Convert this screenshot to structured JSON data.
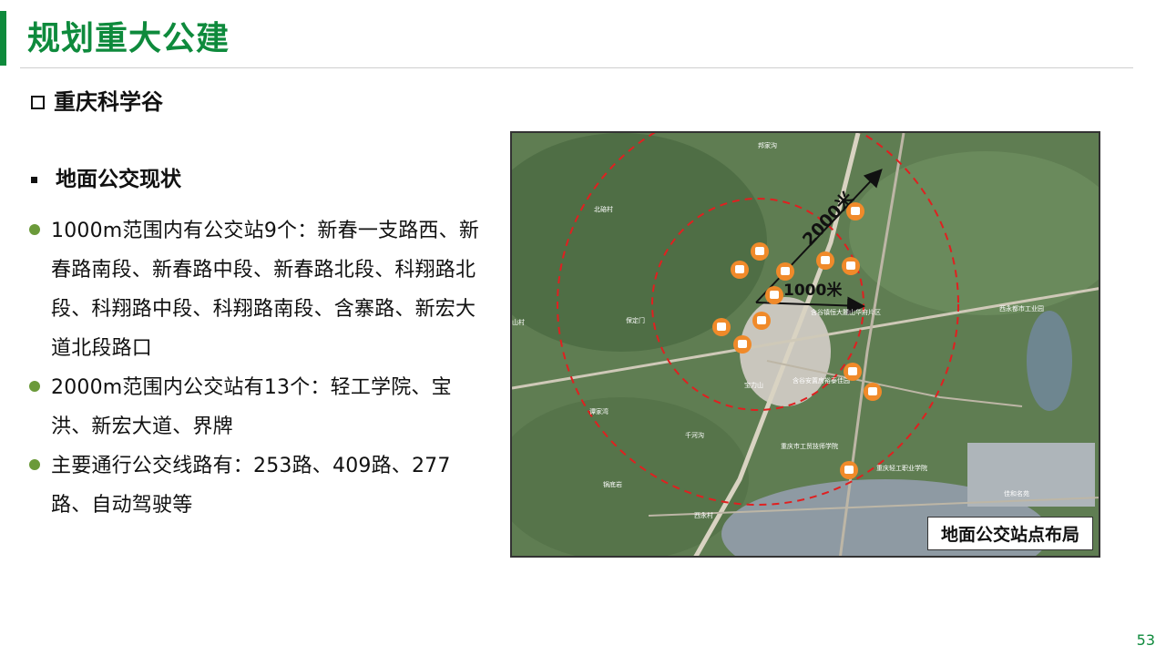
{
  "title": "规划重大公建",
  "subtitle": "重庆科学谷",
  "section_title": "地面公交现状",
  "bullets": [
    "1000m范围内有公交站9个：新春一支路西、新春路南段、新春路中段、新春路北段、科翔路北段、科翔路中段、科翔路南段、含寨路、新宏大道北段路口",
    "2000m范围内公交站有13个：轻工学院、宝洪、新宏大道、界牌",
    "主要通行公交线路有：253路、409路、277路、自动驾驶等"
  ],
  "map": {
    "radius_large_label": "2000米",
    "radius_small_label": "1000米",
    "caption": "地面公交站点布局",
    "place_labels": [
      "邦家沟",
      "北碚村",
      "山村",
      "保定门",
      "含谷镇恒大麓山华府片区",
      "西永都市工业园",
      "宝力山",
      "含谷安置房裕泰佳园",
      "谭家湾",
      "千河沟",
      "重庆市工贸技师学院",
      "重庆轻工职业学院",
      "佳和名苑",
      "锅底岩",
      "西永村"
    ],
    "colors": {
      "ring": "#e02020",
      "stop": "#f08a2a",
      "arrow": "#111111"
    }
  },
  "page_number": "53"
}
